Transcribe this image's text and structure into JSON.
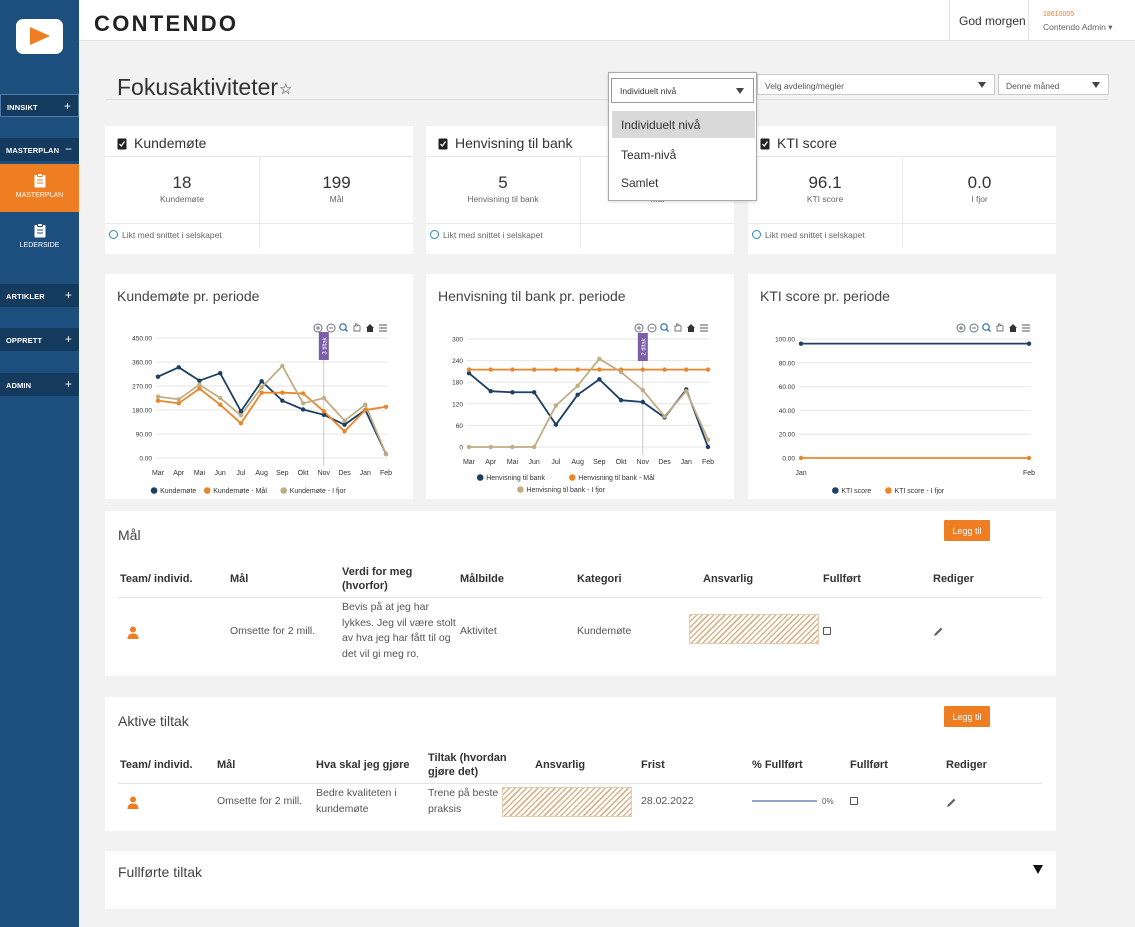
{
  "brand": {
    "name": "CONTENDO",
    "accent": "#ef7d22",
    "navy": "#1c4f7e"
  },
  "topbar": {
    "greeting": "God morgen",
    "user_id": "18610005",
    "user_name": "Contendo Admin ▾"
  },
  "sidebar": {
    "sections": [
      {
        "label": "INNSIKT",
        "toggle": "+"
      },
      {
        "label": "MASTERPLAN",
        "toggle": "−"
      },
      {
        "label": "ARTIKLER",
        "toggle": "+"
      },
      {
        "label": "OPPRETT",
        "toggle": "+"
      },
      {
        "label": "ADMIN",
        "toggle": "+"
      }
    ],
    "items": [
      {
        "label": "MASTERPLAN",
        "icon": "clipboard-icon",
        "active": true
      },
      {
        "label": "LEDERSIDE",
        "icon": "clipboard-icon",
        "active": false
      }
    ]
  },
  "page": {
    "title": "Fokusaktiviteter"
  },
  "filters": {
    "level": "Individuelt nivå",
    "department_placeholder": "Velg avdeling/megler",
    "period": "Denne måned"
  },
  "level_dropdown": {
    "options": [
      "Individuelt nivå",
      "Team-nivå",
      "Samlet"
    ],
    "highlighted": "Individuelt nivå"
  },
  "kpis": [
    {
      "title": "Kundemøte",
      "left_value": "18",
      "left_label": "Kundemøte",
      "right_value": "199",
      "right_label": "Mål",
      "footer": "Likt med snittet i selskapet"
    },
    {
      "title": "Henvisning til bank",
      "left_value": "5",
      "left_label": "Henvisning til bank",
      "right_value": "",
      "right_label": "Mål",
      "footer": "Likt med snittet i selskapet"
    },
    {
      "title": "KTI score",
      "left_value": "96.1",
      "left_label": "KTI score",
      "right_value": "0.0",
      "right_label": "I fjor",
      "footer": "Likt med snittet i selskapet"
    }
  ],
  "chart_data": [
    {
      "type": "line",
      "title": "Kundemøte pr. periode",
      "categories": [
        "Mar",
        "Apr",
        "Mai",
        "Jun",
        "Jul",
        "Aug",
        "Sep",
        "Okt",
        "Nov",
        "Des",
        "Jan",
        "Feb"
      ],
      "y_ticks": [
        "450.00",
        "360.00",
        "270.00",
        "180.00",
        "90.00",
        "0.00"
      ],
      "ylim": [
        0,
        450
      ],
      "annotation": {
        "label": "3 tiltak",
        "at": "Nov"
      },
      "series": [
        {
          "name": "Kundemøte",
          "color": "#1c3f63",
          "values": [
            305,
            340,
            290,
            318,
            175,
            288,
            215,
            182,
            162,
            125,
            180,
            15
          ]
        },
        {
          "name": "Kundemøte - Mål",
          "color": "#e8862c",
          "values": [
            215,
            205,
            260,
            200,
            130,
            245,
            245,
            242,
            175,
            100,
            180,
            192
          ]
        },
        {
          "name": "Kundemøte - I fjor",
          "color": "#c1ad84",
          "values": [
            230,
            220,
            275,
            225,
            160,
            265,
            345,
            205,
            225,
            140,
            200,
            15
          ]
        }
      ]
    },
    {
      "type": "line",
      "title": "Henvisning til bank pr. periode",
      "categories": [
        "Mar",
        "Apr",
        "Mai",
        "Jun",
        "Jul",
        "Aug",
        "Sep",
        "Okt",
        "Nov",
        "Des",
        "Jan",
        "Feb"
      ],
      "y_ticks": [
        "300",
        "240",
        "180",
        "120",
        "60",
        "0"
      ],
      "ylim": [
        0,
        300
      ],
      "annotation": {
        "label": "2 tiltak",
        "at": "Nov"
      },
      "series": [
        {
          "name": "Henvisning til bank",
          "color": "#1c3f63",
          "values": [
            205,
            155,
            152,
            152,
            62,
            145,
            188,
            130,
            125,
            82,
            160,
            0
          ]
        },
        {
          "name": "Henvisning til bank - Mål",
          "color": "#e8862c",
          "values": [
            215,
            215,
            215,
            215,
            215,
            215,
            215,
            215,
            215,
            215,
            215,
            215
          ]
        },
        {
          "name": "Henvisning til bank - I fjor",
          "color": "#c1ad84",
          "values": [
            0,
            0,
            0,
            0,
            115,
            170,
            245,
            208,
            158,
            85,
            155,
            20
          ]
        }
      ]
    },
    {
      "type": "line",
      "title": "KTI score pr. periode",
      "categories": [
        "Jan",
        "Feb"
      ],
      "y_ticks": [
        "100.00",
        "80.00",
        "60.00",
        "40.00",
        "20.00",
        "0.00"
      ],
      "ylim": [
        0,
        100
      ],
      "series": [
        {
          "name": "KTI score",
          "color": "#1c3f63",
          "values": [
            96.1,
            96.1
          ]
        },
        {
          "name": "KTI score - I fjor",
          "color": "#e8862c",
          "values": [
            0,
            0
          ]
        }
      ]
    }
  ],
  "goals": {
    "title": "Mål",
    "add_label": "Legg til",
    "columns": [
      "Team/ individ.",
      "Mål",
      "Verdi for meg (hvorfor)",
      "Målbilde",
      "Kategori",
      "Ansvarlig",
      "Fullført",
      "Rediger"
    ],
    "rows": [
      {
        "goal": "Omsette for 2 mill.",
        "value_for_me": "Bevis på at jeg har lykkes. Jeg vil være stolt av hva jeg har fått til og det vil gi meg ro.",
        "target_image": "Aktivitet",
        "category": "Kundemøte"
      }
    ]
  },
  "actions": {
    "title": "Aktive tiltak",
    "add_label": "Legg til",
    "columns": [
      "Team/ individ.",
      "Mål",
      "Hva skal jeg gjøre",
      "Tiltak (hvordan gjøre det)",
      "Ansvarlig",
      "Frist",
      "% Fullført",
      "Fullført",
      "Rediger"
    ],
    "rows": [
      {
        "goal": "Omsette for 2 mill.",
        "what": "Bedre kvaliteten i kundemøte",
        "how": "Trene på beste praksis",
        "deadline": "28.02.2022",
        "percent": "0%",
        "progress": 0
      }
    ]
  },
  "completed": {
    "title": "Fullførte tiltak"
  }
}
